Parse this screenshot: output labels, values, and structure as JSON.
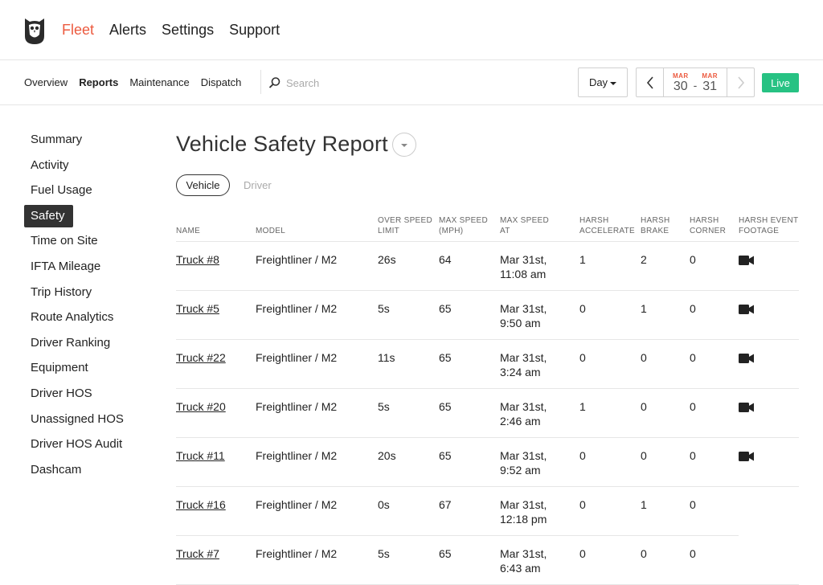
{
  "app": {
    "nav": [
      "Fleet",
      "Alerts",
      "Settings",
      "Support"
    ],
    "active_nav": "Fleet"
  },
  "subnav": {
    "items": [
      "Overview",
      "Reports",
      "Maintenance",
      "Dispatch"
    ],
    "active": "Reports",
    "search_placeholder": "Search"
  },
  "controls": {
    "period": "Day",
    "range_start_month": "MAR",
    "range_start_day": "30",
    "range_sep": "-",
    "range_end_month": "MAR",
    "range_end_day": "31",
    "live_label": "Live"
  },
  "sidebar": {
    "items": [
      "Summary",
      "Activity",
      "Fuel Usage",
      "Safety",
      "Time on Site",
      "IFTA Mileage",
      "Trip History",
      "Route Analytics",
      "Driver Ranking",
      "Equipment",
      "Driver HOS",
      "Unassigned HOS",
      "Driver HOS Audit",
      "Dashcam"
    ],
    "active": "Safety"
  },
  "report": {
    "title": "Vehicle Safety Report",
    "toggle_vehicle": "Vehicle",
    "toggle_driver": "Driver"
  },
  "table": {
    "headers": {
      "name": "NAME",
      "model": "MODEL",
      "over_speed": "OVER SPEED LIMIT",
      "max_speed": "MAX SPEED (MPH)",
      "max_speed_at": "MAX SPEED AT",
      "harsh_accelerate": "HARSH ACCELERATE",
      "harsh_brake": "HARSH BRAKE",
      "harsh_corner": "HARSH CORNER",
      "footage": "HARSH EVENT FOOTAGE"
    },
    "rows": [
      {
        "name": "Truck #8",
        "model": "Freightliner / M2",
        "over_speed": "26s",
        "max_speed": "64",
        "at_line1": "Mar 31st,",
        "at_line2": "11:08 am",
        "acc": "1",
        "brake": "2",
        "corner": "0",
        "footage": true
      },
      {
        "name": "Truck #5",
        "model": "Freightliner / M2",
        "over_speed": "5s",
        "max_speed": "65",
        "at_line1": "Mar 31st,",
        "at_line2": "9:50 am",
        "acc": "0",
        "brake": "1",
        "corner": "0",
        "footage": true
      },
      {
        "name": "Truck #22",
        "model": "Freightliner / M2",
        "over_speed": "11s",
        "max_speed": "65",
        "at_line1": "Mar 31st,",
        "at_line2": "3:24 am",
        "acc": "0",
        "brake": "0",
        "corner": "0",
        "footage": true
      },
      {
        "name": "Truck #20",
        "model": "Freightliner / M2",
        "over_speed": "5s",
        "max_speed": "65",
        "at_line1": "Mar 31st,",
        "at_line2": "2:46 am",
        "acc": "1",
        "brake": "0",
        "corner": "0",
        "footage": true
      },
      {
        "name": "Truck #11",
        "model": "Freightliner / M2",
        "over_speed": "20s",
        "max_speed": "65",
        "at_line1": "Mar 31st,",
        "at_line2": "9:52 am",
        "acc": "0",
        "brake": "0",
        "corner": "0",
        "footage": true
      },
      {
        "name": "Truck #16",
        "model": "Freightliner / M2",
        "over_speed": "0s",
        "max_speed": "67",
        "at_line1": "Mar 31st,",
        "at_line2": "12:18 pm",
        "acc": "0",
        "brake": "1",
        "corner": "0",
        "footage": false
      },
      {
        "name": "Truck #7",
        "model": "Freightliner / M2",
        "over_speed": "5s",
        "max_speed": "65",
        "at_line1": "Mar 31st,",
        "at_line2": "6:43 am",
        "acc": "0",
        "brake": "0",
        "corner": "0",
        "footage": false
      }
    ]
  },
  "colors": {
    "accent": "#ec5a3f",
    "live": "#27c283",
    "active_sidebar": "#333333"
  },
  "icons": {
    "logo": "owl-logo-icon",
    "search": "search-icon",
    "prev": "chevron-left-icon",
    "next": "chevron-right-icon",
    "footage": "video-camera-icon",
    "title_dropdown": "caret-down-icon"
  }
}
